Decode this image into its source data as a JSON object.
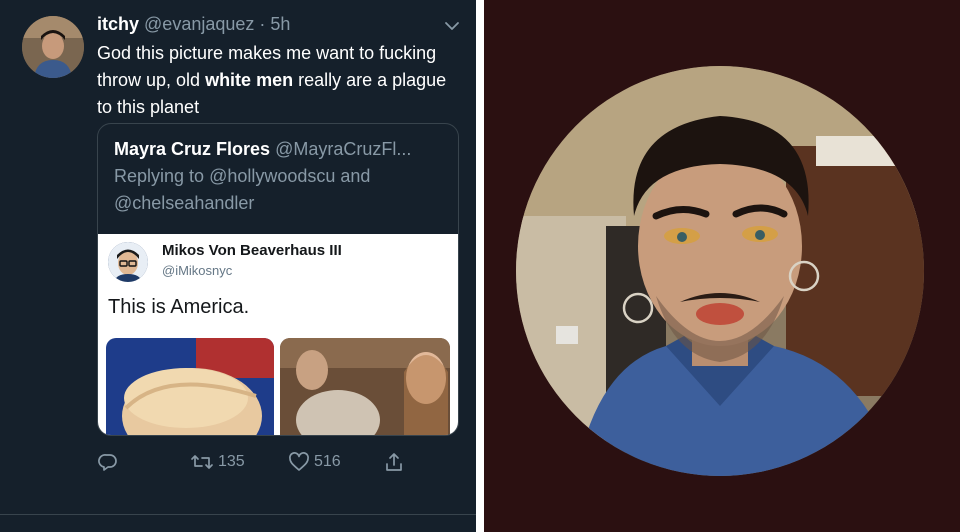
{
  "tweet": {
    "display_name": "itchy",
    "handle": "@evanjaquez",
    "separator": " · ",
    "time": "5h",
    "text_part1": "God this picture makes me want to fucking throw up, old ",
    "text_bold": "white men",
    "text_part2": " really are a plague to this planet"
  },
  "quote": {
    "name": "Mayra Cruz Flores",
    "handle": "@MayraCruzFl...",
    "replying_prefix": "Replying to ",
    "replying_to_1": "@hollywoodscu",
    "replying_and": " and",
    "replying_to_2": "@chelseahandler"
  },
  "inner_tweet": {
    "name": "Mikos Von Beaverhaus III",
    "handle": "@iMikosnyc",
    "text": "This is America."
  },
  "actions": {
    "retweets": "135",
    "likes": "516",
    "reply_icon": "reply-icon",
    "retweet_icon": "retweet-icon",
    "like_icon": "heart-icon",
    "share_icon": "share-icon"
  },
  "colors": {
    "panel_bg": "#15202b",
    "right_bg": "#2b1011",
    "secondary_text": "#8899a6"
  }
}
